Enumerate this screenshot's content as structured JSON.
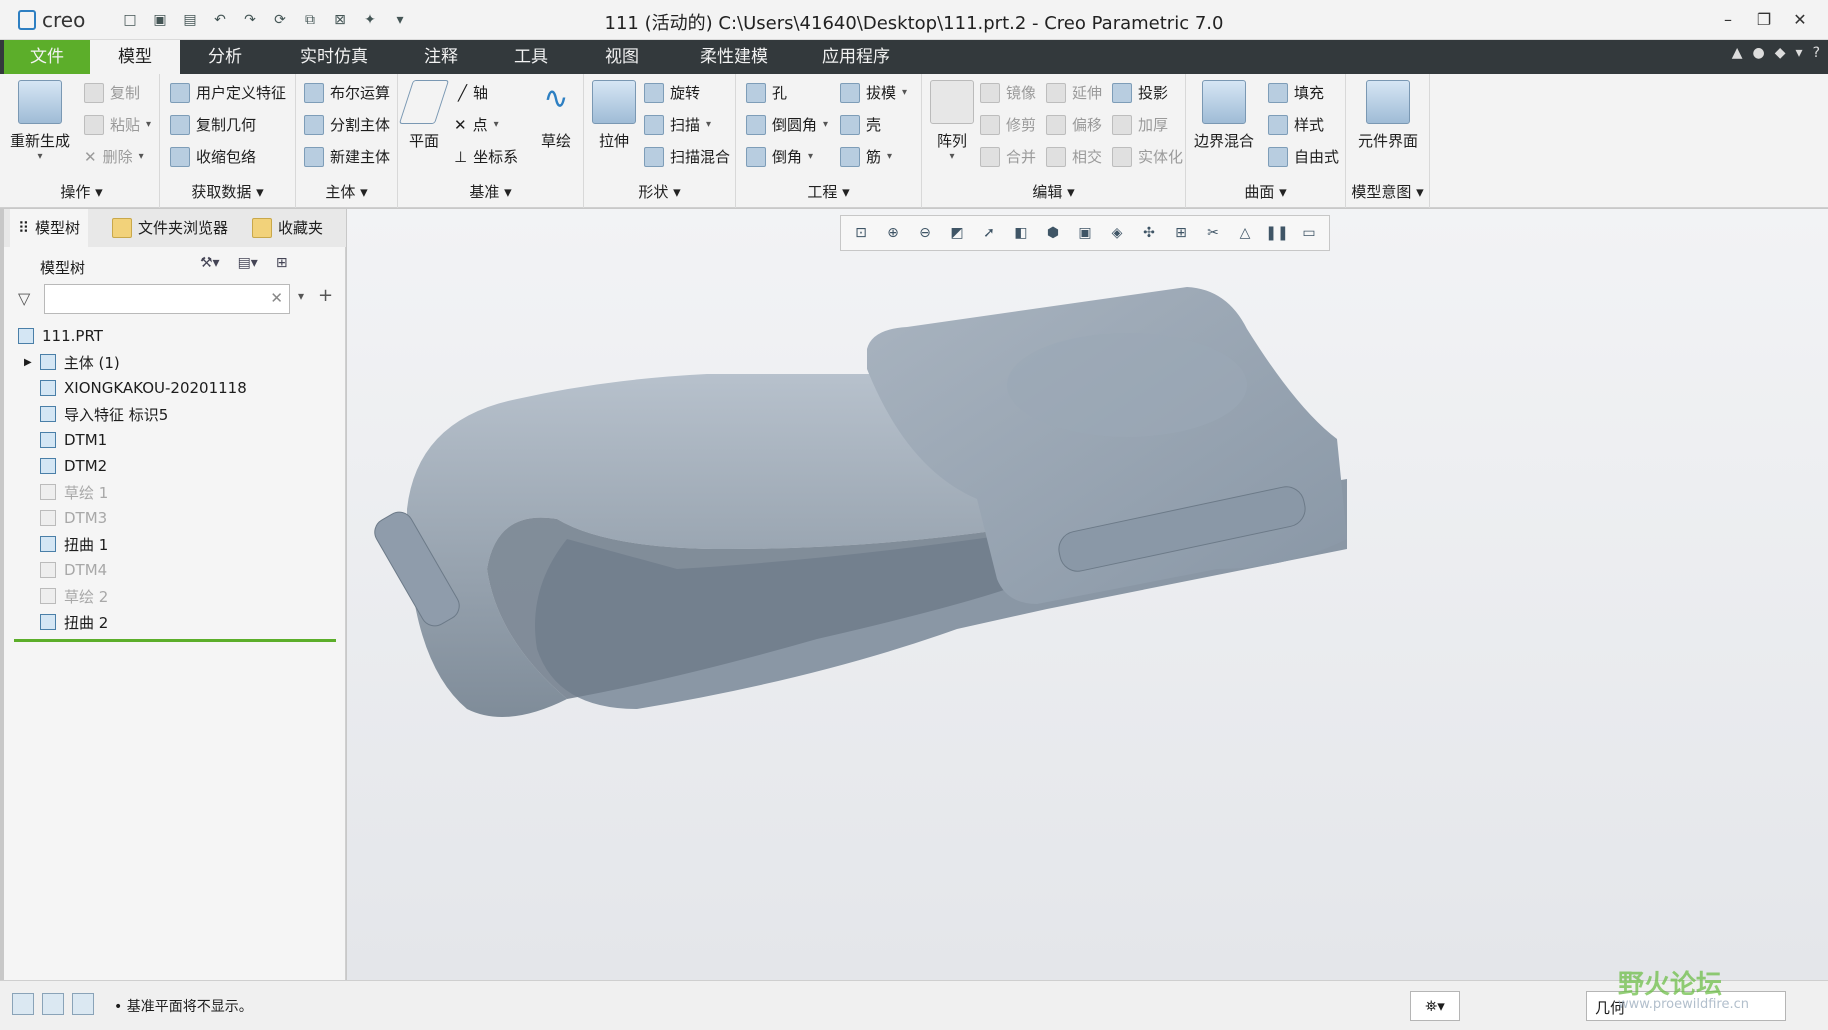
{
  "window": {
    "app_name": "creo",
    "title": "111 (活动的) C:\\Users\\41640\\Desktop\\111.prt.2 - Creo Parametric 7.0",
    "controls": [
      "–",
      "❐",
      "✕"
    ]
  },
  "menu": {
    "tabs": [
      "文件",
      "模型",
      "分析",
      "实时仿真",
      "注释",
      "工具",
      "视图",
      "柔性建模",
      "应用程序"
    ],
    "active": "模型"
  },
  "ribbon": {
    "operations": {
      "label": "操作 ▾",
      "big": "重新生成",
      "items": [
        "复制",
        "粘贴",
        "删除"
      ]
    },
    "get_data": {
      "label": "获取数据 ▾",
      "items": [
        "用户定义特征",
        "复制几何",
        "收缩包络"
      ]
    },
    "body": {
      "label": "主体 ▾",
      "items": [
        "布尔运算",
        "分割主体",
        "新建主体"
      ]
    },
    "datum": {
      "label": "基准 ▾",
      "plane": "平面",
      "sketch": "草绘",
      "items": [
        "轴",
        "点",
        "坐标系"
      ]
    },
    "shape": {
      "label": "形状 ▾",
      "extrude": "拉伸",
      "items": [
        "旋转",
        "扫描",
        "扫描混合"
      ]
    },
    "engineering": {
      "label": "工程 ▾",
      "items": [
        "孔",
        "倒圆角",
        "倒角",
        "拔模",
        "壳",
        "筋"
      ]
    },
    "edit": {
      "label": "编辑 ▾",
      "array": "阵列",
      "items": [
        "镜像",
        "修剪",
        "合并",
        "延伸",
        "偏移",
        "相交",
        "投影",
        "加厚",
        "实体化"
      ]
    },
    "surface": {
      "label": "曲面 ▾",
      "boundary": "边界混合",
      "items": [
        "填充",
        "样式",
        "自由式"
      ]
    },
    "model_intent": {
      "label": "模型意图 ▾",
      "big": "元件界面"
    }
  },
  "left_panel": {
    "tabs": [
      "模型树",
      "文件夹浏览器",
      "收藏夹"
    ],
    "header": "模型树",
    "filter_placeholder": "",
    "tree": [
      {
        "label": "111.PRT",
        "dim": false
      },
      {
        "label": "主体 (1)",
        "dim": false
      },
      {
        "label": "XIONGKAKOU-20201118",
        "dim": false
      },
      {
        "label": "导入特征 标识5",
        "dim": false
      },
      {
        "label": "DTM1",
        "dim": false
      },
      {
        "label": "DTM2",
        "dim": false
      },
      {
        "label": "草绘 1",
        "dim": true
      },
      {
        "label": "DTM3",
        "dim": true
      },
      {
        "label": "扭曲 1",
        "dim": false
      },
      {
        "label": "DTM4",
        "dim": true
      },
      {
        "label": "草绘 2",
        "dim": true
      },
      {
        "label": "扭曲 2",
        "dim": false
      }
    ]
  },
  "status": {
    "message": "• 基准平面将不显示。",
    "filter_value": "几何"
  },
  "watermark": {
    "text": "野火论坛",
    "url": "www.proewildfire.cn"
  },
  "colors": {
    "file_tab": "#5cae2a",
    "menubar": "#33393c",
    "model": "#9aa6b4"
  }
}
